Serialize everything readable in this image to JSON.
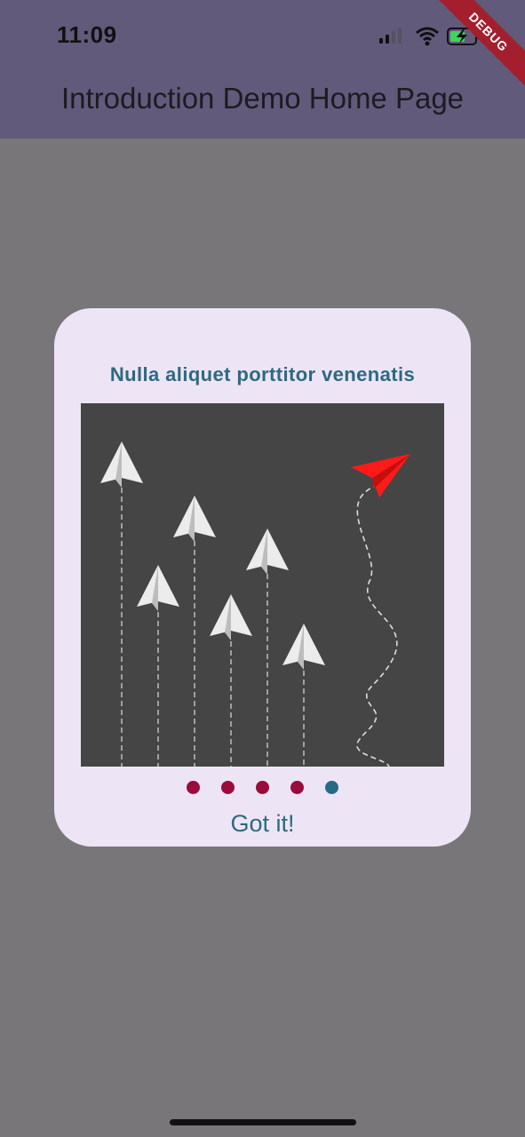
{
  "status_bar": {
    "time": "11:09",
    "debug_label": "DEBUG"
  },
  "app_bar": {
    "title": "Introduction Demo Home Page"
  },
  "dialog": {
    "slide_title": "Nulla aliquet porttitor venenatis",
    "image": {
      "background": "#454545",
      "planes": 7,
      "highlight_plane_color": "#ff1a1a"
    },
    "dots": {
      "count": 5,
      "active_index": 4,
      "inactive_color": "#9a0c3a",
      "active_color": "#256b84"
    },
    "done_label": "Got it!"
  }
}
